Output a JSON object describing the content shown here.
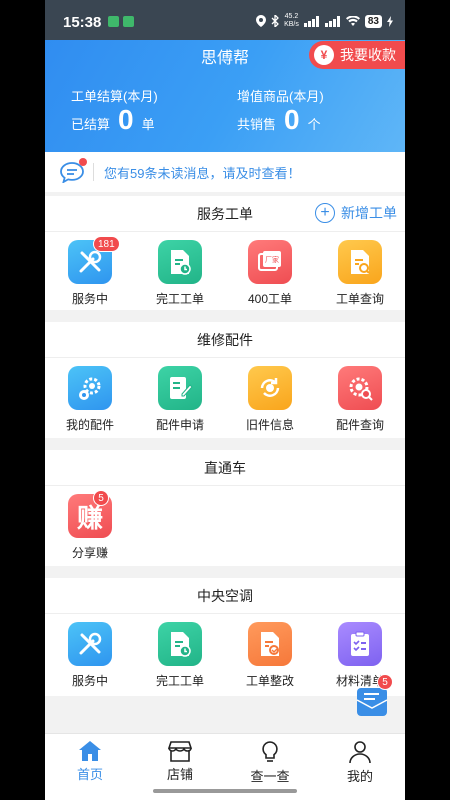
{
  "status": {
    "time": "15:38",
    "speed": "45.2\nKB/s",
    "net1": "4G",
    "net2": "4G",
    "battery": "83"
  },
  "header": {
    "title": "思傅帮",
    "collect_label": "我要收款",
    "collect_icon": "¥",
    "left_stat": {
      "label": "工单结算(本月)",
      "prefix": "已结算",
      "value": "0",
      "unit": "单"
    },
    "right_stat": {
      "label": "增值商品(本月)",
      "prefix": "共销售",
      "value": "0",
      "unit": "个"
    }
  },
  "notice": {
    "text": "您有59条未读消息，请及时查看！"
  },
  "sections": {
    "service": {
      "title": "服务工单",
      "add_label": "新增工单",
      "items": [
        {
          "label": "服务中",
          "badge": "181",
          "icon": "tools-icon"
        },
        {
          "label": "完工工单",
          "icon": "completed-doc-icon"
        },
        {
          "label": "400工单",
          "icon": "factory-doc-icon",
          "tag": "厂家"
        },
        {
          "label": "工单查询",
          "icon": "doc-search-icon"
        }
      ]
    },
    "parts": {
      "title": "维修配件",
      "items": [
        {
          "label": "我的配件",
          "icon": "gears-icon"
        },
        {
          "label": "配件申请",
          "icon": "form-edit-icon"
        },
        {
          "label": "旧件信息",
          "icon": "recycle-gear-icon"
        },
        {
          "label": "配件查询",
          "icon": "gear-search-icon"
        }
      ]
    },
    "express": {
      "title": "直通车",
      "items": [
        {
          "label": "分享赚",
          "badge": "5",
          "glyph": "赚"
        }
      ]
    },
    "hvac": {
      "title": "中央空调",
      "items": [
        {
          "label": "服务中",
          "icon": "tools-icon"
        },
        {
          "label": "完工工单",
          "icon": "completed-doc-icon"
        },
        {
          "label": "工单整改",
          "icon": "doc-fix-icon"
        },
        {
          "label": "材料清单",
          "icon": "checklist-icon"
        }
      ]
    }
  },
  "float": {
    "badge": "5"
  },
  "tabs": [
    {
      "label": "首页",
      "active": true
    },
    {
      "label": "店铺"
    },
    {
      "label": "查一查"
    },
    {
      "label": "我的"
    }
  ]
}
